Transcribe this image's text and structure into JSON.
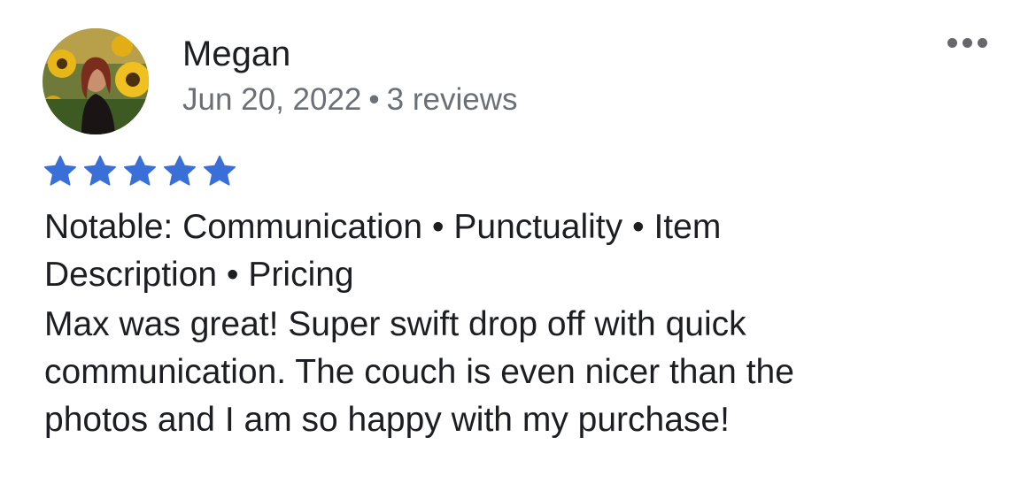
{
  "reviewer": {
    "name": "Megan",
    "date": "Jun 20, 2022",
    "separator": "•",
    "review_count": "3 reviews",
    "avatar_icon": "profile-photo-sunflowers"
  },
  "menu": {
    "icon": "more-options-icon"
  },
  "rating": {
    "stars": 5,
    "max": 5,
    "color": "#3b6fd8"
  },
  "notable": {
    "line1": "Notable: Communication • Punctuality • Item",
    "line2": "Description • Pricing"
  },
  "review": {
    "line1": "Max was great! Super swift drop off with quick",
    "line2": "communication. The couch is even nicer than the",
    "line3": "photos and I am so happy with my purchase!"
  },
  "colors": {
    "text": "#1c1e21",
    "secondary": "#6b6f76",
    "star": "#3b6fd8"
  }
}
